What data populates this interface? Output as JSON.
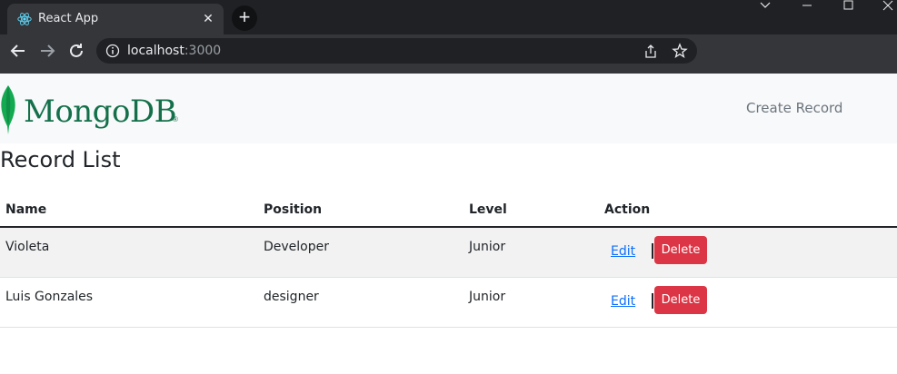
{
  "browser": {
    "tab_title": "React App",
    "url_host": "localhost",
    "url_port": ":3000"
  },
  "navbar": {
    "brand": "MongoDB",
    "create_link": "Create Record"
  },
  "page": {
    "title": "Record List"
  },
  "table": {
    "headers": [
      "Name",
      "Position",
      "Level",
      "Action"
    ],
    "rows": [
      {
        "name": "Violeta",
        "position": "Developer",
        "level": "Junior",
        "edit": "Edit",
        "delete": "Delete"
      },
      {
        "name": "Luis Gonzales",
        "position": "designer",
        "level": "Junior",
        "edit": "Edit",
        "delete": "Delete"
      }
    ]
  },
  "colors": {
    "brand_green": "#13704a",
    "delete_red": "#dc3545",
    "link_blue": "#0d6efd"
  }
}
